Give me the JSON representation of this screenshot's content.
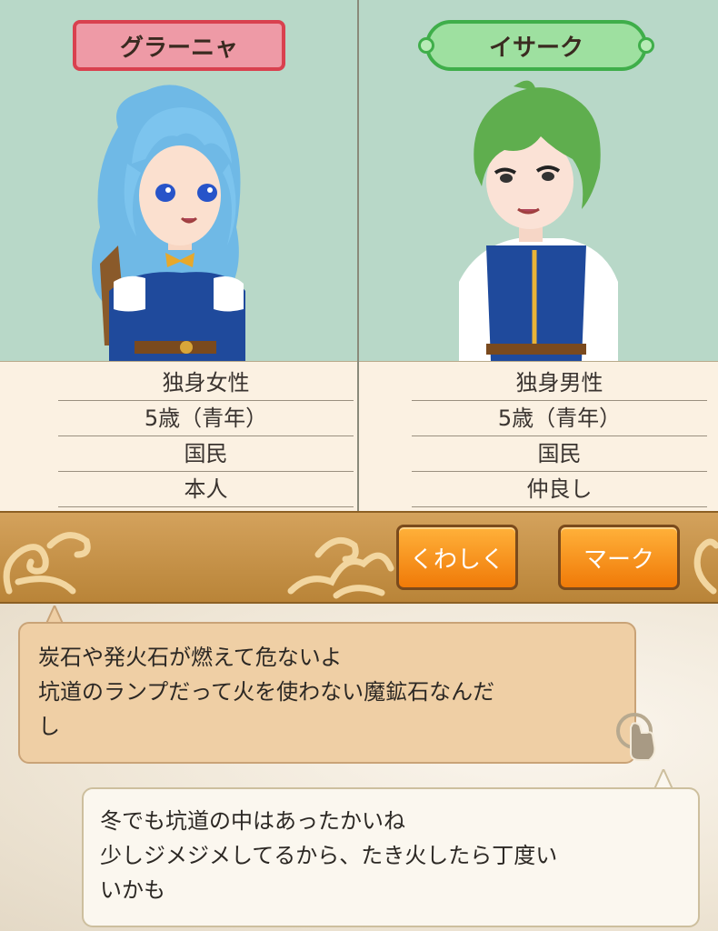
{
  "characters": [
    {
      "name": "グラーニャ",
      "info": [
        "独身女性",
        "5歳（青年）",
        "国民",
        "本人"
      ],
      "colors": {
        "hair": "#7cc4ee",
        "outfit": "#1f4a9c"
      }
    },
    {
      "name": "イサーク",
      "info": [
        "独身男性",
        "5歳（青年）",
        "国民",
        "仲良し"
      ],
      "colors": {
        "hair": "#5fae4e",
        "outfit": "#1f4a9c"
      }
    }
  ],
  "buttons": {
    "detail": "くわしく",
    "mark": "マーク"
  },
  "dialog": {
    "npc_lines": [
      "炭石や発火石が燃えて危ないよ",
      "坑道のランプだって火を使わない魔鉱石なんだ",
      "し"
    ],
    "player_lines": [
      "冬でも坑道の中はあったかいね",
      "少しジメジメしてるから、たき火したら丁度い",
      "いかも"
    ]
  },
  "theme": {
    "panel_bg": "#b8d8c8",
    "info_bg": "#fbf1e2",
    "bar": "#c8944a",
    "button": "#f58a10"
  }
}
